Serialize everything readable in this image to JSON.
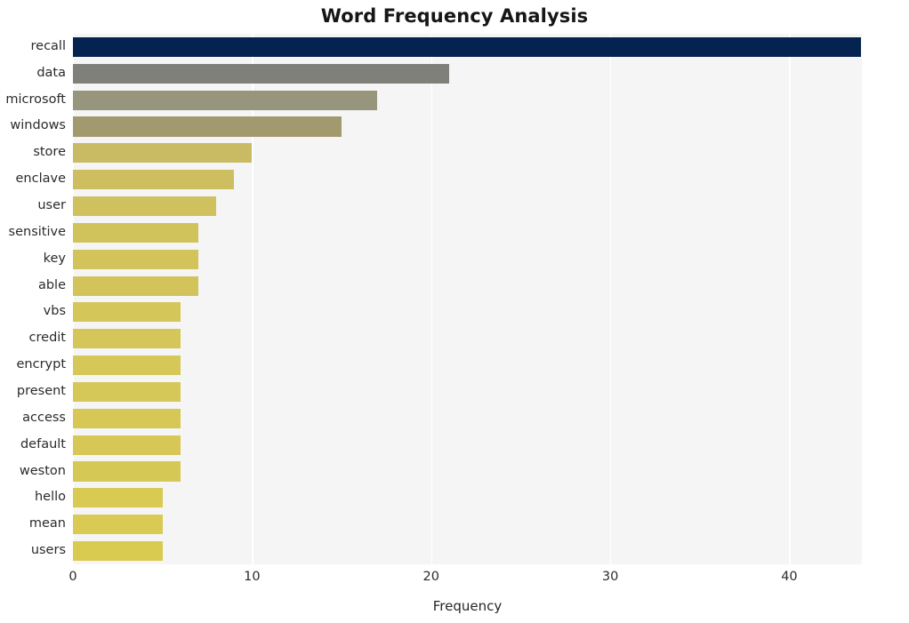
{
  "chart_data": {
    "type": "bar",
    "orientation": "horizontal",
    "title": "Word Frequency Analysis",
    "xlabel": "Frequency",
    "ylabel": "",
    "categories": [
      "recall",
      "data",
      "microsoft",
      "windows",
      "store",
      "enclave",
      "user",
      "sensitive",
      "key",
      "able",
      "vbs",
      "credit",
      "encrypt",
      "present",
      "access",
      "default",
      "weston",
      "hello",
      "mean",
      "users"
    ],
    "values": [
      44,
      21,
      17,
      15,
      10,
      9,
      8,
      7,
      7,
      7,
      6,
      6,
      6,
      6,
      6,
      6,
      6,
      5,
      5,
      5
    ],
    "bar_colors": [
      "#052350",
      "#80807a",
      "#97957c",
      "#a3996f",
      "#c8bb63",
      "#cdbf60",
      "#cfc15e",
      "#d1c35c",
      "#d2c45b",
      "#d2c45b",
      "#d4c659",
      "#d4c659",
      "#d5c758",
      "#d5c758",
      "#d6c756",
      "#d6c756",
      "#d6c855",
      "#d8ca52",
      "#d8ca52",
      "#d9cb50"
    ],
    "xlim": [
      0,
      44.05
    ],
    "xticks": [
      0,
      10,
      20,
      30,
      40
    ],
    "xtick_labels": [
      "0",
      "10",
      "20",
      "30",
      "40"
    ],
    "grid": true,
    "grid_axis": "x",
    "legend": "none",
    "plot_background": "#f5f5f6",
    "grid_color": "#ffffff",
    "figure_background": "#ffffff"
  }
}
